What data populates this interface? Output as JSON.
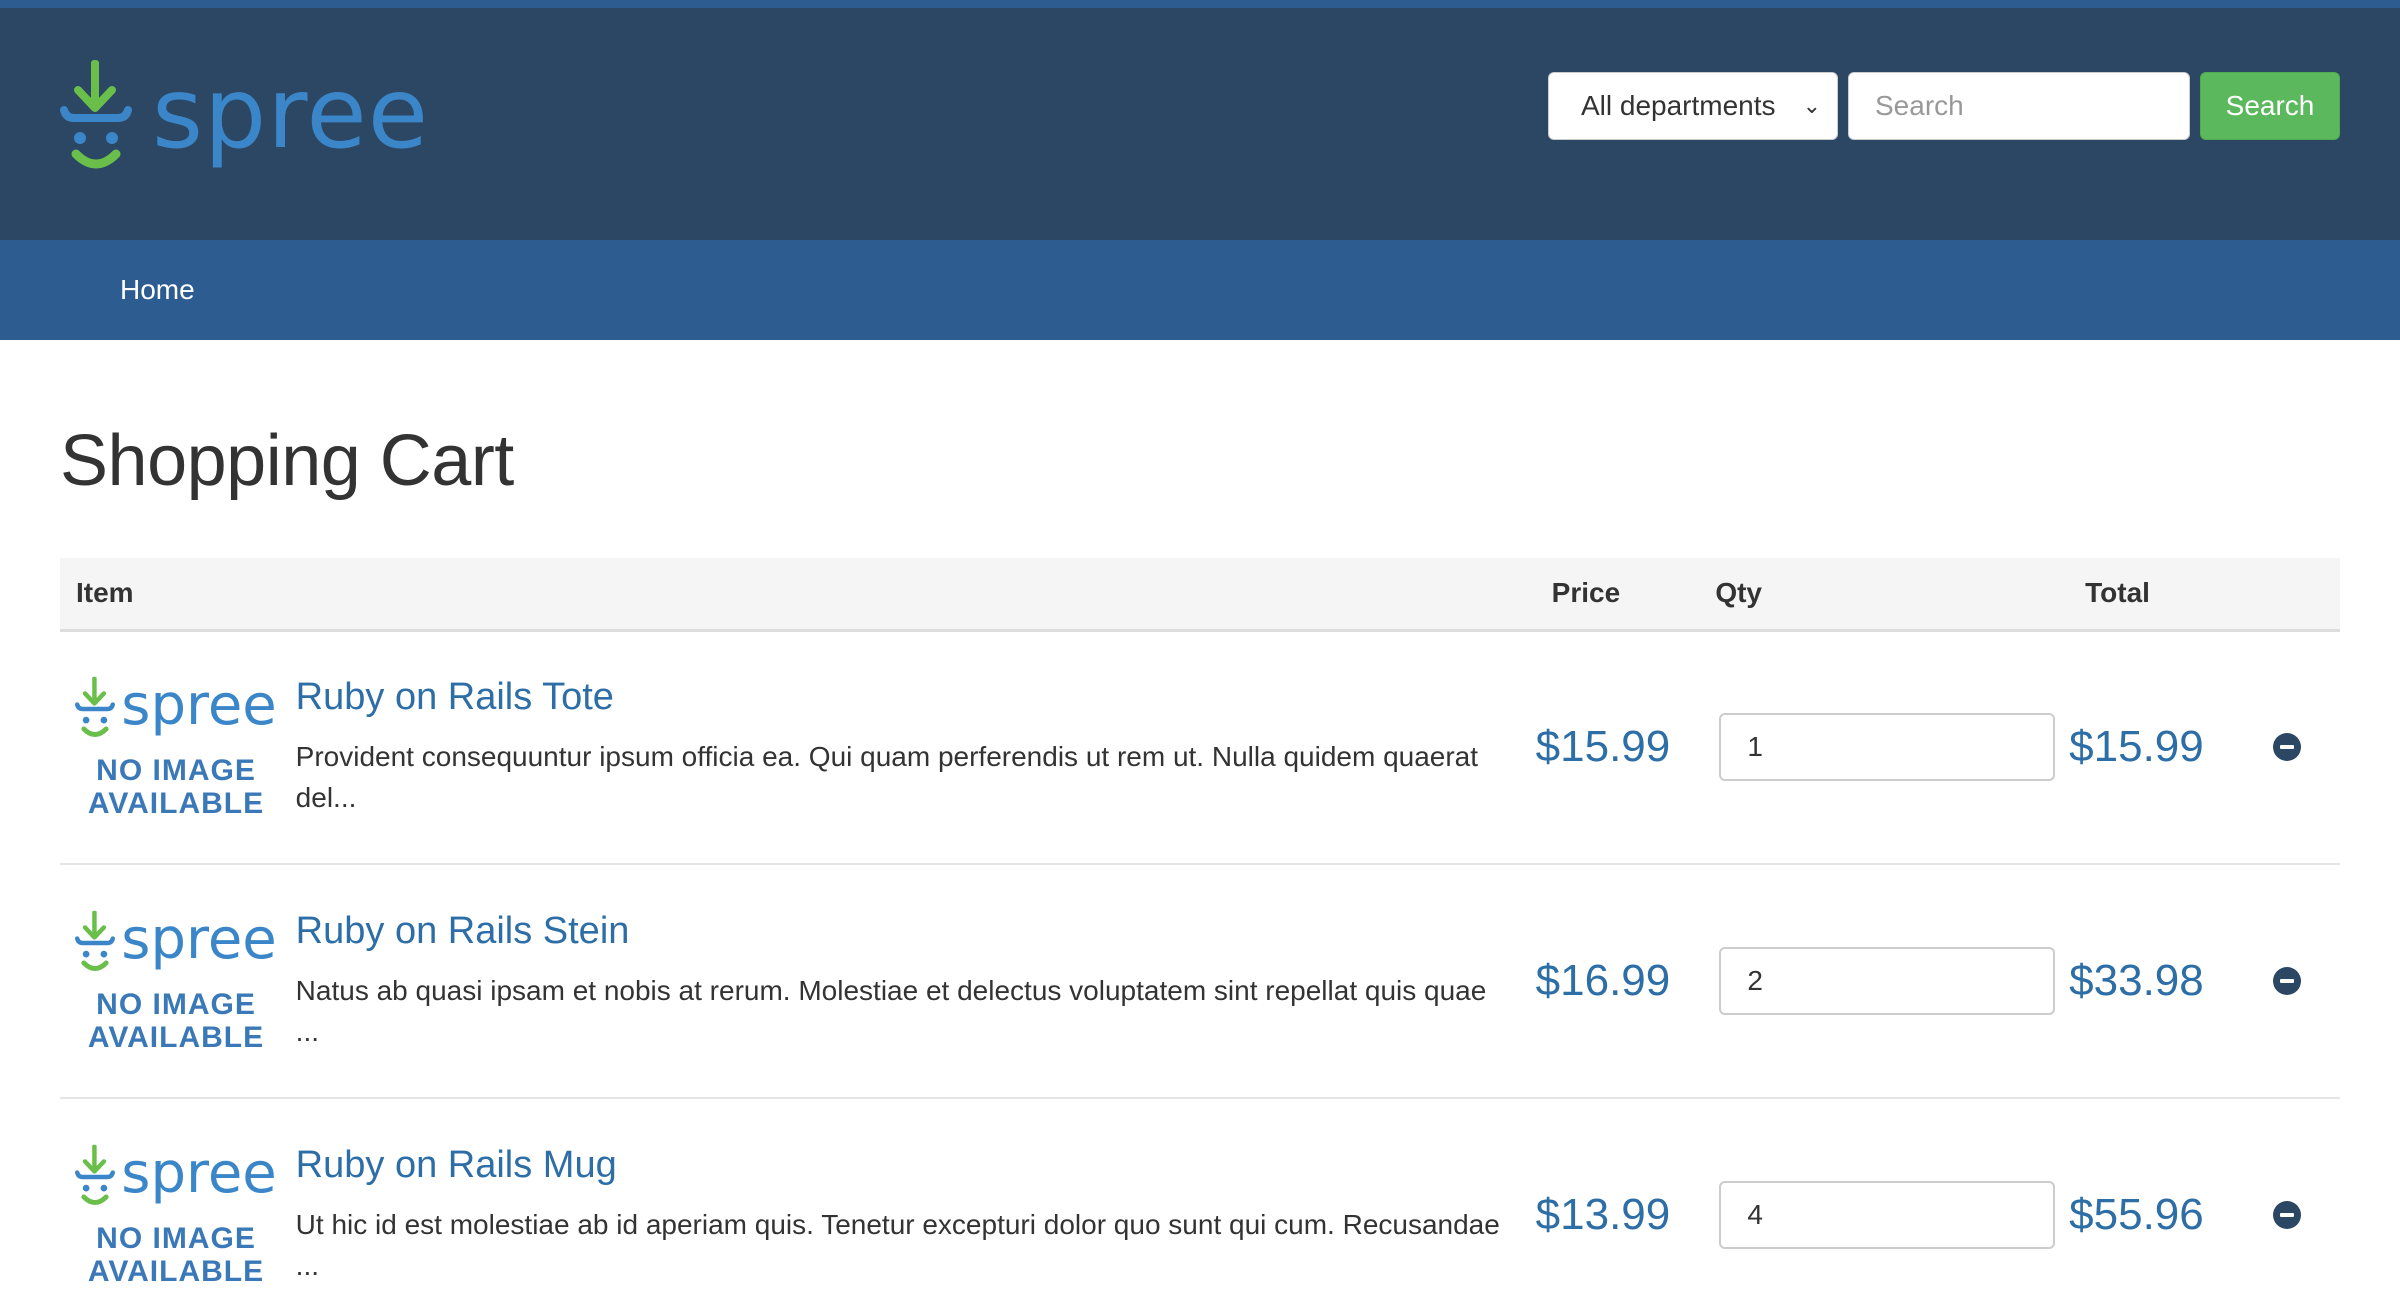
{
  "brand": {
    "name": "spree"
  },
  "header": {
    "department_select": {
      "selected": "All departments"
    },
    "search": {
      "placeholder": "Search",
      "button_label": "Search"
    }
  },
  "nav": {
    "items": [
      {
        "label": "Home"
      }
    ]
  },
  "page": {
    "title": "Shopping Cart"
  },
  "cart": {
    "columns": {
      "item": "Item",
      "price": "Price",
      "qty": "Qty",
      "total": "Total"
    },
    "no_image_text": "NO IMAGE AVAILABLE",
    "items": [
      {
        "name": "Ruby on Rails Tote",
        "description": "Provident consequuntur ipsum officia ea. Qui quam perferendis ut rem ut. Nulla quidem quaerat del...",
        "price": "$15.99",
        "qty": "1",
        "total": "$15.99"
      },
      {
        "name": "Ruby on Rails Stein",
        "description": "Natus ab quasi ipsam et nobis at rerum. Molestiae et delectus voluptatem sint repellat quis quae ...",
        "price": "$16.99",
        "qty": "2",
        "total": "$33.98"
      },
      {
        "name": "Ruby on Rails Mug",
        "description": "Ut hic id est molestiae ab id aperiam quis. Tenetur excepturi dolor quo sunt qui cum. Recusandae ...",
        "price": "$13.99",
        "qty": "4",
        "total": "$55.96"
      }
    ]
  },
  "colors": {
    "header_bg": "#2c4763",
    "nav_bg": "#2d5c91",
    "search_button": "#5cb85c",
    "link": "#2d6ea6",
    "logo_green": "#6abf4b",
    "logo_blue": "#3a86c8"
  },
  "icons": {
    "remove": "minus-circle-icon",
    "logo": "spree-cart-icon"
  }
}
